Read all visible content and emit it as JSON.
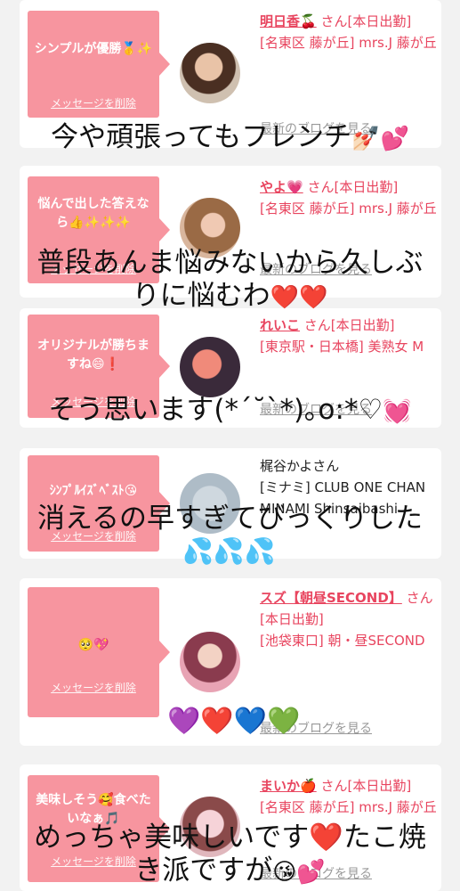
{
  "cards": [
    {
      "bubble_message": "シンプルが優勝🥇✨",
      "delete_label": "メッセージを削除",
      "name": "明日香🍒",
      "san_label": "さん[本日出勤]",
      "shop": "[名東区 藤が丘] mrs.J 藤が丘",
      "blog_link": "最新のブログを見る"
    },
    {
      "bubble_message": "悩んで出した答えなら👍✨✨✨",
      "delete_label": "メッセージを削除",
      "name": "やよ💗",
      "san_label": "さん[本日出勤]",
      "shop": "[名東区 藤が丘] mrs.J 藤が丘",
      "blog_link": "最新のブログを見る"
    },
    {
      "bubble_message": "オリジナルが勝ちますね😄❗",
      "delete_label": "メッセージを削除",
      "name": "れいこ",
      "san_label": "さん[本日出勤]",
      "shop": "[東京駅・日本橋] 美熟女 M",
      "blog_link": "最新のブログを見る"
    },
    {
      "bubble_message": "ｼﾝﾌﾟﾙｲｽﾞﾍﾞｽﾄ😘",
      "delete_label": "メッセージを削除",
      "name": "梶谷かよさん",
      "san_label": "",
      "shop": "[ミナミ] CLUB ONE CHAN MINAMI Shinsaibashi",
      "blog_link": ""
    },
    {
      "bubble_message": "🥺💖",
      "delete_label": "メッセージを削除",
      "name": "スズ【朝昼SECOND】",
      "san_label": "さん[本日出勤]",
      "shop": "[池袋東口] 朝・昼SECOND",
      "blog_link": "最新のブログを見る"
    },
    {
      "bubble_message": "美味しそう🥰食べたいなぁ🎵",
      "delete_label": "メッセージを削除",
      "name": "まいか🍎",
      "san_label": "さん[本日出勤]",
      "shop": "[名東区 藤が丘] mrs.J 藤が丘",
      "blog_link": "最新のブログを見る"
    }
  ],
  "overlays": [
    {
      "text": "今や頑張ってもフレンチ",
      "emoji": "💅🏻💕"
    },
    {
      "text": "普段あんま悩みないから久しぶ",
      "text2": "りに悩むわ",
      "emoji": "❤️❤️"
    },
    {
      "text": "そう思います(*ˊ˘ˋ*)｡o:*♡",
      "emoji": "💓"
    },
    {
      "text": "消えるの早すぎてびっくりした",
      "emoji": "💦💦💦"
    },
    {
      "text": "",
      "emoji": "💜❤️💙💚"
    },
    {
      "text": "めっちゃ美味しいです❤️たこ焼",
      "text2": "き派ですが",
      "emoji": "😘💕"
    }
  ],
  "colors": {
    "accent": "#e8455f",
    "bubble": "#f7959f",
    "background": "#f2f2f2"
  }
}
